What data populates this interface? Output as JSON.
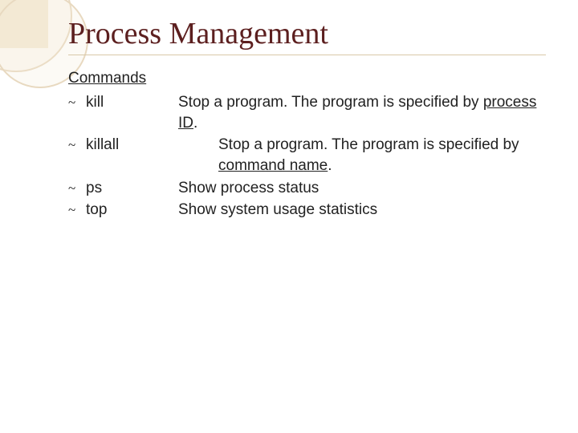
{
  "title": "Process Management",
  "section_label": "Commands",
  "commands": [
    {
      "name": "kill",
      "desc_pre": "Stop a program. The program is specified by ",
      "desc_u": "process ID",
      "desc_post": ".",
      "indent": false
    },
    {
      "name": "killall",
      "desc_pre": "Stop a program. The program  is specified by ",
      "desc_u": "command name",
      "desc_post": ".",
      "indent": true
    },
    {
      "name": "ps",
      "desc_pre": "Show process status",
      "desc_u": "",
      "desc_post": "",
      "indent": false
    },
    {
      "name": "top",
      "desc_pre": "Show system usage statistics",
      "desc_u": "",
      "desc_post": "",
      "indent": false
    }
  ],
  "bullet_glyph": "~"
}
